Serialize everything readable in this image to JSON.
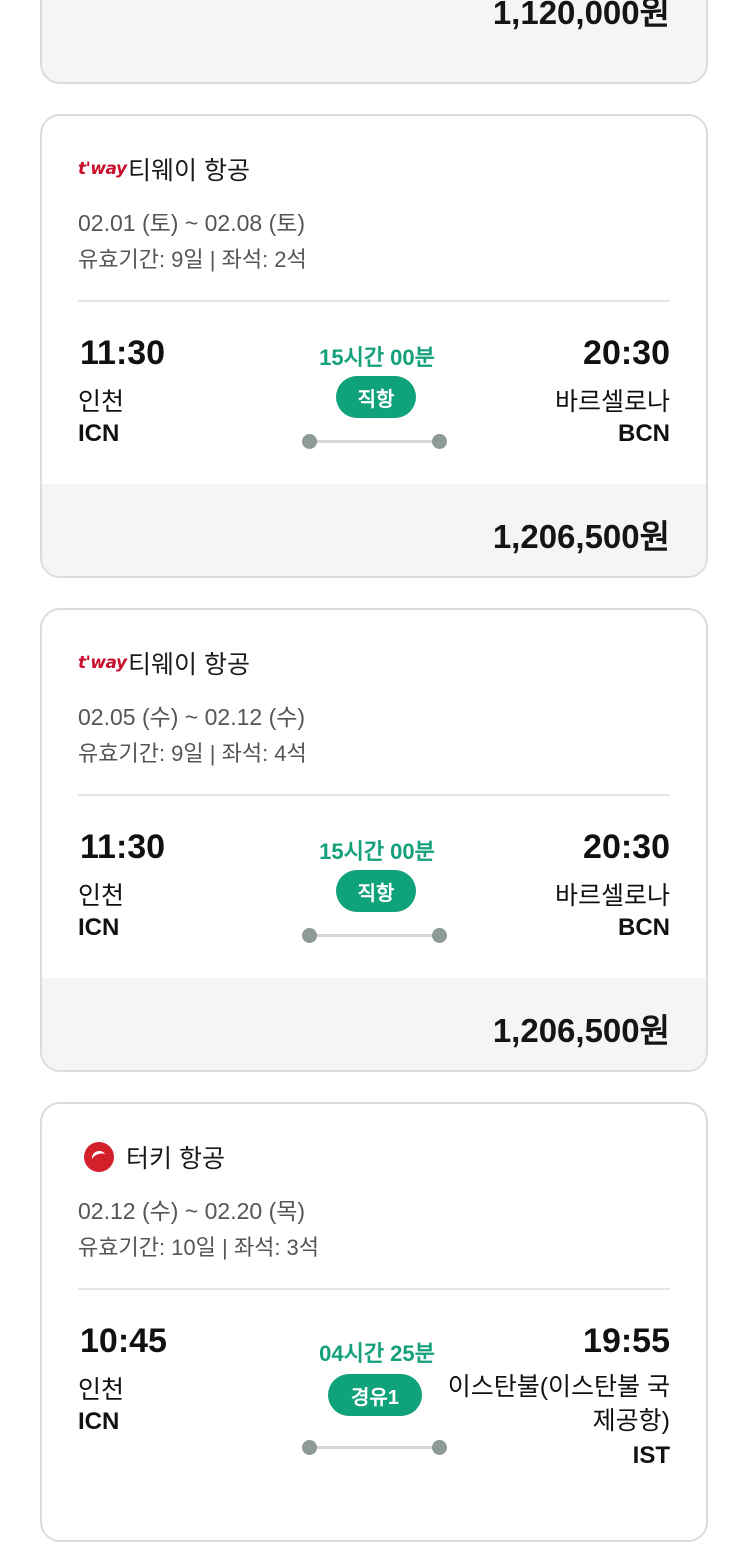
{
  "top_card": {
    "price": "1,120,000원"
  },
  "cards": [
    {
      "airline": "티웨이 항공",
      "logo": "t'way",
      "dates": "02.01 (토) ~ 02.08 (토)",
      "validity": "유효기간: 9일 | 좌석: 2석",
      "dep_time": "11:30",
      "dep_city": "인천",
      "dep_code": "ICN",
      "arr_time": "20:30",
      "arr_city": "바르셀로나",
      "arr_code": "BCN",
      "duration": "15시간 00분",
      "type": "직항",
      "price": "1,206,500원"
    },
    {
      "airline": "티웨이 항공",
      "logo": "t'way",
      "dates": "02.05 (수) ~ 02.12 (수)",
      "validity": "유효기간: 9일 | 좌석: 4석",
      "dep_time": "11:30",
      "dep_city": "인천",
      "dep_code": "ICN",
      "arr_time": "20:30",
      "arr_city": "바르셀로나",
      "arr_code": "BCN",
      "duration": "15시간 00분",
      "type": "직항",
      "price": "1,206,500원"
    },
    {
      "airline": "터키 항공",
      "logo_icon": "turkish-airlines-logo",
      "dates": "02.12 (수) ~ 02.20 (목)",
      "validity": "유효기간: 10일 | 좌석: 3석",
      "dep_time": "10:45",
      "dep_city": "인천",
      "dep_code": "ICN",
      "arr_time": "19:55",
      "arr_city_line1": "이스탄불(이스탄불 국",
      "arr_city_line2": "제공항)",
      "arr_code": "IST",
      "duration": "04시간 25분",
      "type": "경유1"
    }
  ],
  "colors": {
    "accent": "#10a27b",
    "tway": "#c8102e",
    "turkish": "#d3212c"
  }
}
